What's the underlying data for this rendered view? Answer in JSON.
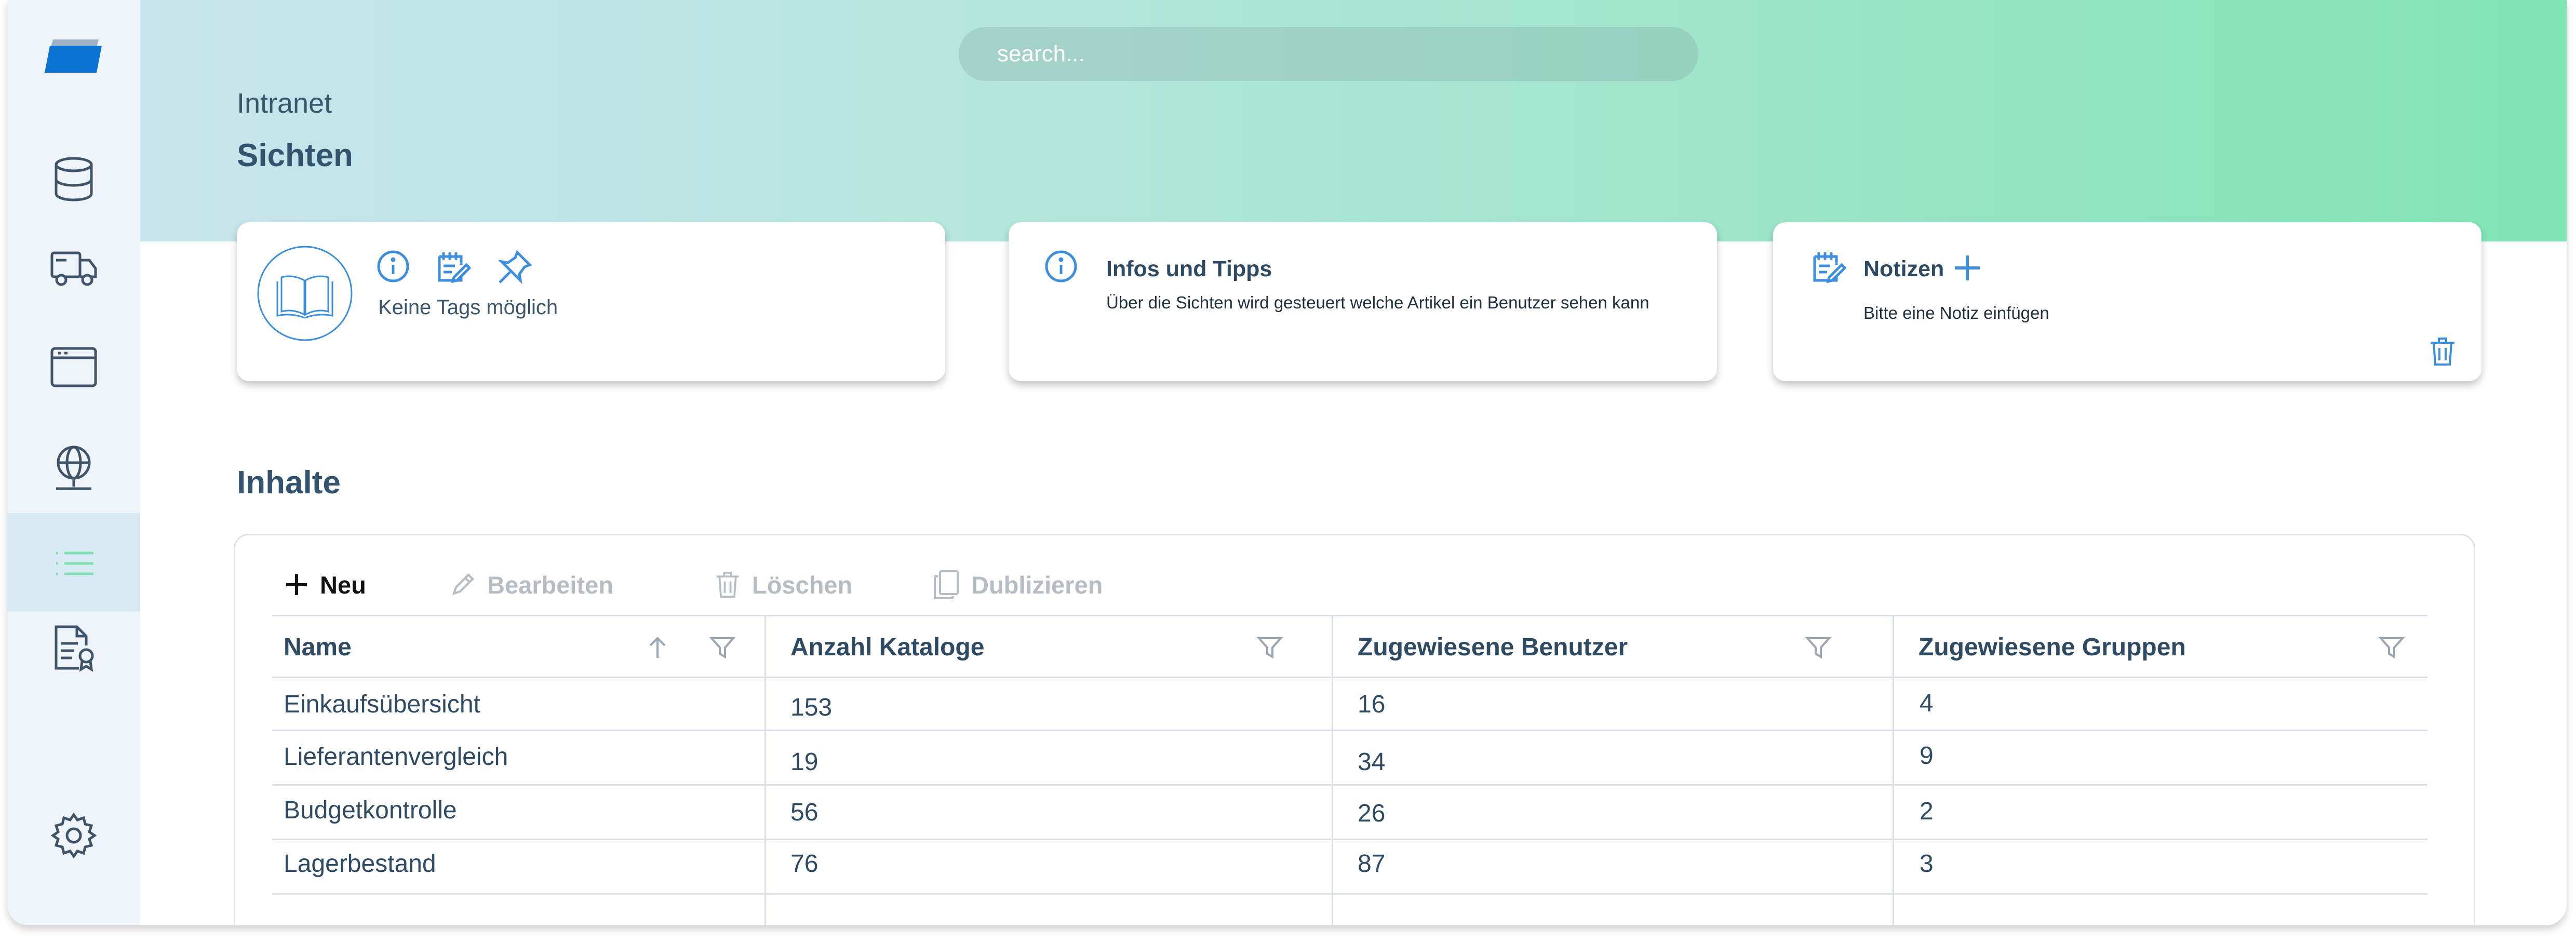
{
  "search": {
    "placeholder": "search..."
  },
  "breadcrumb": "Intranet",
  "page_title": "Sichten",
  "cards": {
    "tags": {
      "label": "Keine Tags möglich"
    },
    "info": {
      "title": "Infos und Tipps",
      "text": "Über die Sichten wird gesteuert welche Artikel ein Benutzer sehen kann"
    },
    "notes": {
      "title": "Notizen",
      "text": "Bitte eine Notiz einfügen"
    }
  },
  "section_title": "Inhalte",
  "toolbar": {
    "new_label": "Neu",
    "edit_label": "Bearbeiten",
    "delete_label": "Löschen",
    "duplicate_label": "Dublizieren"
  },
  "table": {
    "columns": [
      "Name",
      "Anzahl Kataloge",
      "Zugewiesene Benutzer",
      "Zugewiesene Gruppen"
    ],
    "rows": [
      [
        "Einkaufsübersicht",
        "153",
        "16",
        "4"
      ],
      [
        "Lieferantenvergleich",
        "19",
        "34",
        "9"
      ],
      [
        "Budgetkontrolle",
        "56",
        "26",
        "2"
      ],
      [
        "Lagerbestand",
        "76",
        "87",
        "3"
      ]
    ]
  },
  "colors": {
    "accent": "#3d8fdd",
    "active_sidebar_icon": "#7fe0b0",
    "brand_blue": "#0a72d0"
  },
  "sidebar": {
    "items": [
      {
        "icon": "database-icon"
      },
      {
        "icon": "truck-icon"
      },
      {
        "icon": "browser-window-icon"
      },
      {
        "icon": "globe-network-icon"
      },
      {
        "icon": "list-icon",
        "active": true
      },
      {
        "icon": "document-certificate-icon"
      },
      {
        "icon": "gear-icon"
      }
    ]
  }
}
